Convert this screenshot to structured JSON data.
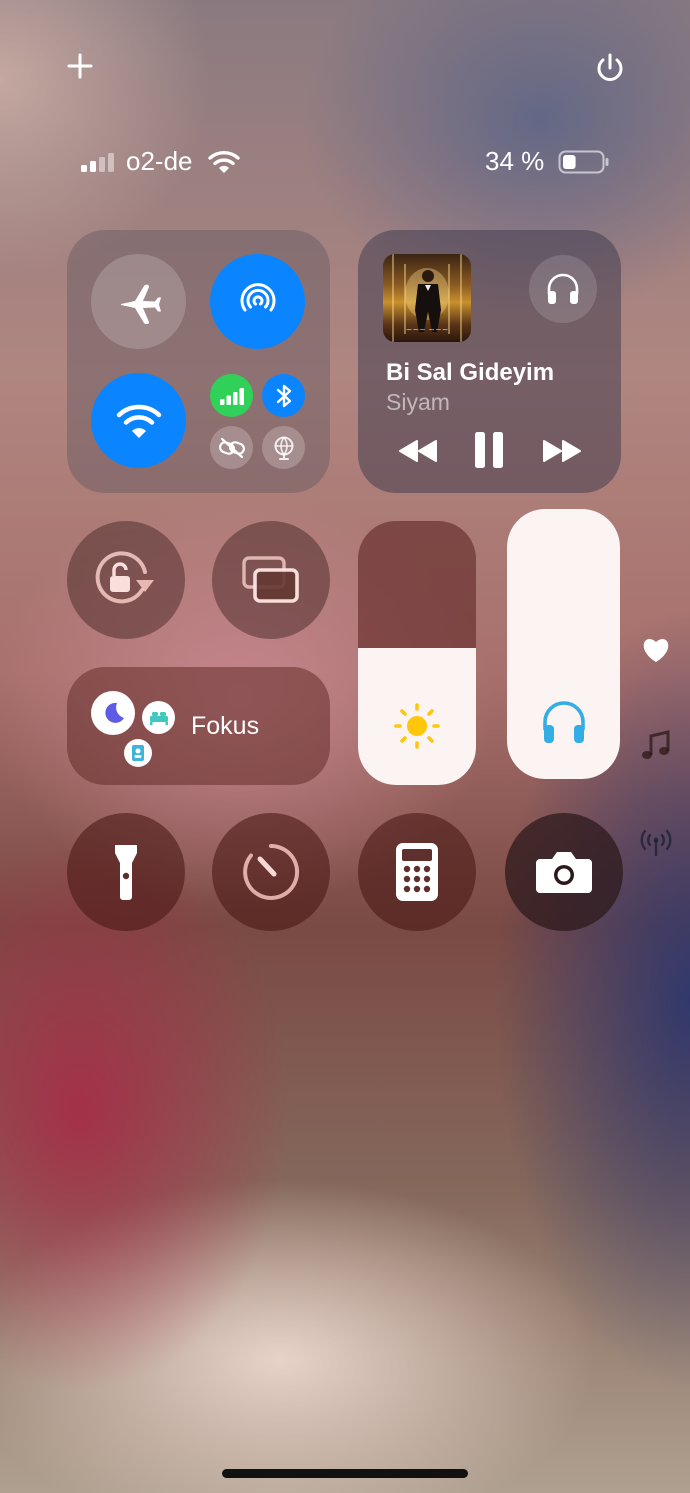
{
  "top": {
    "add_icon": "plus-icon",
    "power_icon": "power-icon"
  },
  "status_bar": {
    "carrier": "o2-de",
    "battery_text": "34 %",
    "battery_level": 0.34
  },
  "connectivity": {
    "airplane": {
      "icon": "airplane-icon",
      "active": false
    },
    "airdrop": {
      "icon": "airdrop-icon",
      "active": true,
      "color": "#0a84ff"
    },
    "wifi": {
      "icon": "wifi-icon",
      "active": true,
      "color": "#0a84ff"
    },
    "cellular": {
      "icon": "cellular-icon",
      "active": true,
      "color": "#30d158"
    },
    "bluetooth": {
      "icon": "bluetooth-icon",
      "active": true,
      "color": "#0a84ff"
    },
    "hotspot": {
      "icon": "link-icon",
      "active": false
    },
    "vpn": {
      "icon": "globe-icon",
      "active": false
    }
  },
  "now_playing": {
    "title": "Bi Sal Gideyim",
    "artist": "Siyam",
    "output_icon": "headphones-icon",
    "controls": [
      "rewind-icon",
      "pause-icon",
      "fast-forward-icon"
    ]
  },
  "controls": {
    "rotation_lock": "rotation-lock-icon",
    "screen_mirroring": "screen-mirroring-icon",
    "focus_label": "Fokus",
    "brightness_level": 0.52,
    "volume_level": 1.0
  },
  "side_icons": [
    "heart-icon",
    "music-note-icon",
    "antenna-icon"
  ],
  "bottom_row": [
    "flashlight-icon",
    "timer-icon",
    "calculator-icon",
    "camera-icon"
  ]
}
